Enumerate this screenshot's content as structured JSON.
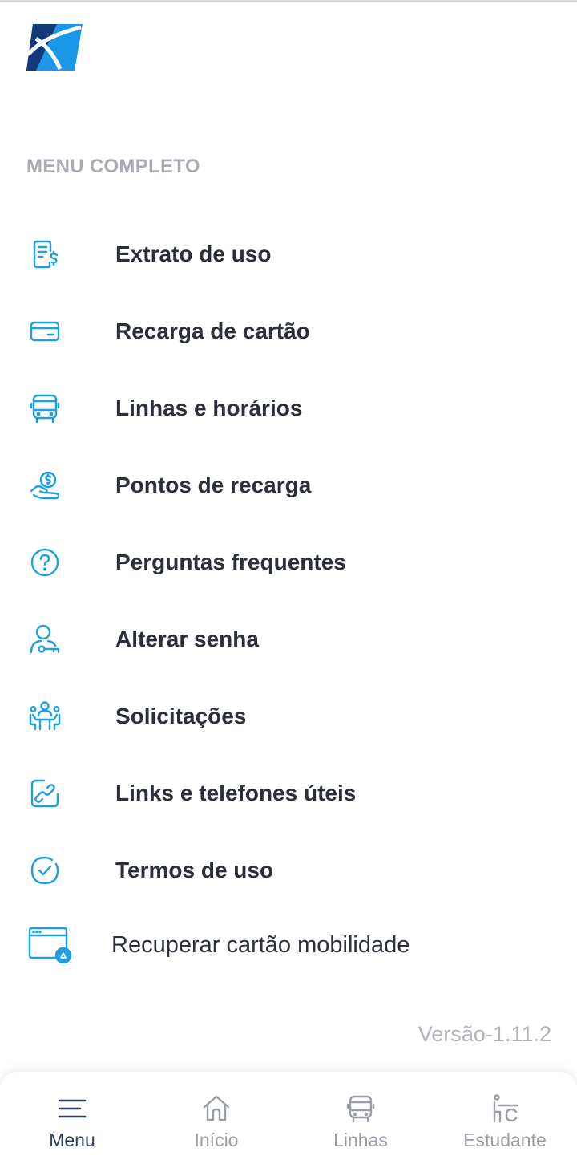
{
  "colors": {
    "icon_blue": "#1e9fe0",
    "logo_dark": "#123a7a",
    "logo_light": "#1b97e8",
    "text_dark": "#2a2f3a",
    "muted": "#a9acb3",
    "nav_active": "#2c3e5c"
  },
  "menu": {
    "section_title": "MENU COMPLETO",
    "items": [
      {
        "label": "Extrato de uso",
        "icon": "receipt-dollar-icon"
      },
      {
        "label": "Recarga de cartão",
        "icon": "credit-card-icon"
      },
      {
        "label": "Linhas e horários",
        "icon": "bus-icon"
      },
      {
        "label": "Pontos de recarga",
        "icon": "hand-coin-icon"
      },
      {
        "label": "Perguntas frequentes",
        "icon": "question-circle-icon"
      },
      {
        "label": "Alterar senha",
        "icon": "user-key-icon"
      },
      {
        "label": "Solicitações",
        "icon": "group-meeting-icon"
      },
      {
        "label": "Links e telefones úteis",
        "icon": "link-icon"
      },
      {
        "label": "Termos de uso",
        "icon": "check-circle-icon"
      },
      {
        "label": "Recuperar cartão mobilidade",
        "icon": "card-recycle-icon"
      }
    ]
  },
  "version": "Versão-1.11.2",
  "bottom_nav": {
    "items": [
      {
        "label": "Menu",
        "icon": "hamburger-icon",
        "active": true
      },
      {
        "label": "Início",
        "icon": "home-icon",
        "active": false
      },
      {
        "label": "Linhas",
        "icon": "bus-icon",
        "active": false
      },
      {
        "label": "Estudante",
        "icon": "student-desk-icon",
        "active": false
      }
    ]
  }
}
